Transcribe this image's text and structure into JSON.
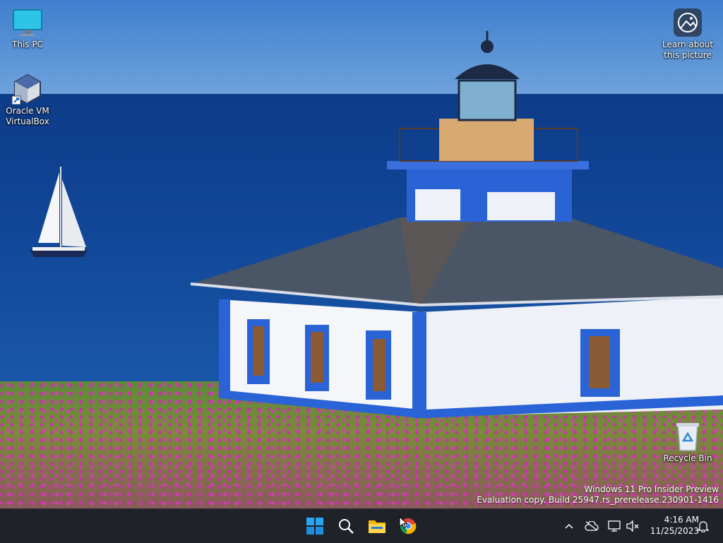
{
  "desktop": {
    "icons": [
      {
        "label": "This PC"
      },
      {
        "label": "Oracle VM VirtualBox"
      },
      {
        "label": "Learn about this picture"
      },
      {
        "label": "Recycle Bin"
      }
    ],
    "watermark": {
      "line1": "Windows 11 Pro Insider Preview",
      "line2": "Evaluation copy. Build 25947.rs_prerelease.230901-1416"
    }
  },
  "taskbar": {
    "apps": [
      "start-icon",
      "search-icon",
      "file-explorer-icon",
      "chrome-icon"
    ],
    "clock": {
      "time": "4:16 AM",
      "date": "11/25/2023"
    }
  },
  "colors": {
    "taskbar": "#1f2228",
    "accent": "#0078d4"
  }
}
